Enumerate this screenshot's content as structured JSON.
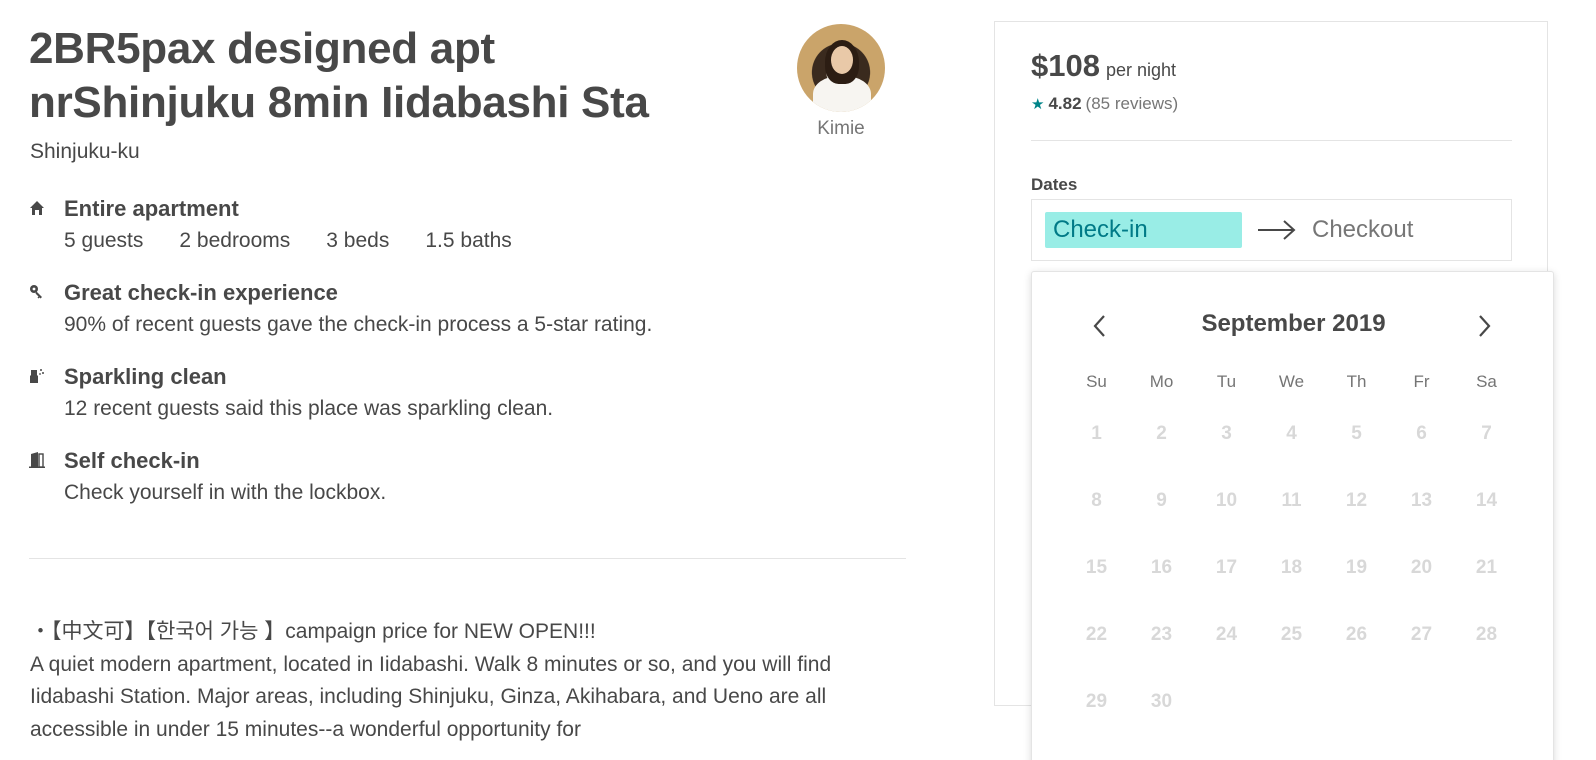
{
  "listing": {
    "title_line1": "2BR5pax designed apt",
    "title_line2": "nrShinjuku 8min Iidabashi Sta",
    "location": "Shinjuku-ku"
  },
  "host": {
    "name": "Kimie"
  },
  "features": [
    {
      "icon": "home-icon",
      "name": "Entire apartment",
      "specs": [
        "5 guests",
        "2 bedrooms",
        "3 beds",
        "1.5 baths"
      ]
    },
    {
      "icon": "key-icon",
      "name": "Great check-in experience",
      "desc": "90% of recent guests gave the check-in process a 5-star rating."
    },
    {
      "icon": "spray-bottle-icon",
      "name": "Sparkling clean",
      "desc": "12 recent guests said this place was sparkling clean."
    },
    {
      "icon": "door-icon",
      "name": "Self check-in",
      "desc": "Check yourself in with the lockbox."
    }
  ],
  "description": {
    "line1": "・【中文可】【한국어 가능 】campaign price for NEW OPEN!!!",
    "line2": "A quiet modern apartment, located in Iidabashi. Walk 8 minutes or so, and you will find Iidabashi Station. Major areas, including Shinjuku, Ginza, Akihabara, and Ueno are all accessible in under 15 minutes--a wonderful opportunity for"
  },
  "booking": {
    "price": "$108",
    "per_night": "per night",
    "rating": "4.82",
    "reviews": "(85 reviews)",
    "dates_label": "Dates",
    "checkin": "Check-in",
    "checkout": "Checkout",
    "accent_color": "#008489",
    "checkin_highlight_color": "#99ede6"
  },
  "calendar": {
    "month": "September 2019",
    "weekdays": [
      "Su",
      "Mo",
      "Tu",
      "We",
      "Th",
      "Fr",
      "Sa"
    ],
    "days": [
      "1",
      "2",
      "3",
      "4",
      "5",
      "6",
      "7",
      "8",
      "9",
      "10",
      "11",
      "12",
      "13",
      "14",
      "15",
      "16",
      "17",
      "18",
      "19",
      "20",
      "21",
      "22",
      "23",
      "24",
      "25",
      "26",
      "27",
      "28",
      "29",
      "30"
    ]
  }
}
